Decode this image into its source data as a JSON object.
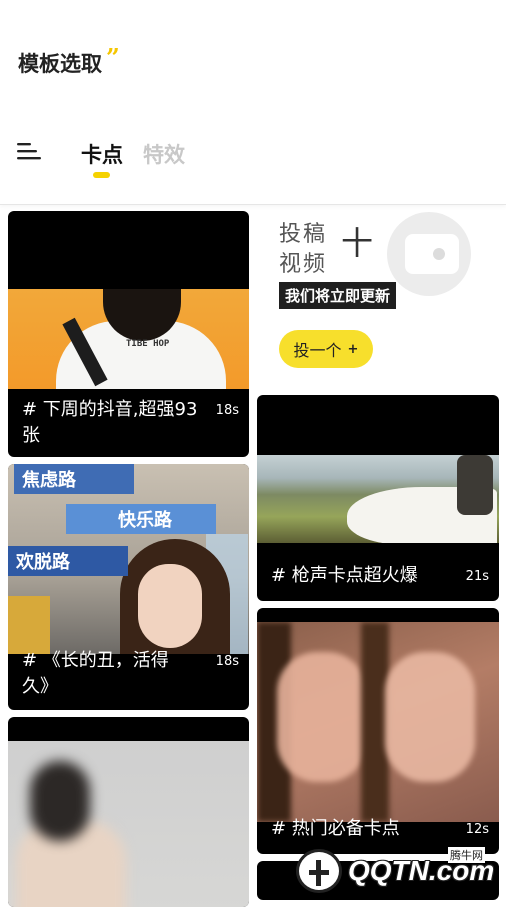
{
  "header": {
    "title": "模板选取",
    "title_mark": "”",
    "tabs": [
      {
        "label": "卡点",
        "active": true
      },
      {
        "label": "特效",
        "active": false
      }
    ],
    "accent_color": "#f5d200"
  },
  "promo": {
    "line1": "投稿",
    "plus": "十",
    "line2": "视频",
    "tagline": "我们将立即更新",
    "button_label": "投一个",
    "button_icon": "+"
  },
  "cards": [
    {
      "caption": "#  下周的抖音,超强93张",
      "caption_line1": "#  下周的抖音,超强93",
      "caption_line2": "张",
      "duration": "18s"
    },
    {
      "caption": "#  《长的丑，活得久》",
      "caption_line1": "#  《长的丑，活得",
      "caption_line2": "久》",
      "duration": "18s",
      "signs": [
        "焦虑路",
        "快乐路",
        "欢脱路"
      ]
    },
    {
      "caption": "#  枪声卡点超火爆",
      "duration": "21s"
    },
    {
      "caption": "#  热门必备卡点",
      "duration": "12s"
    }
  ],
  "watermark": {
    "brand": "QQTN.com",
    "label": "腾牛网"
  },
  "shirt_print": "TIBE HOP"
}
